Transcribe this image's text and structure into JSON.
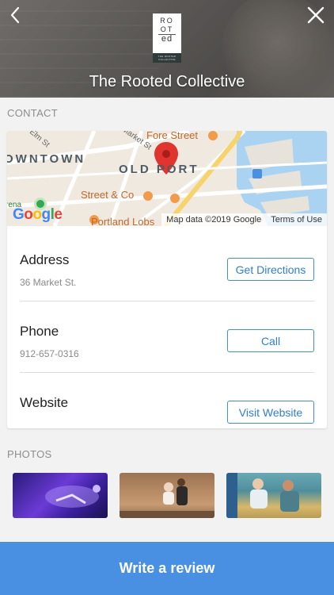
{
  "header": {
    "title": "The Rooted Collective",
    "back_icon": "chevron-left-icon",
    "close_icon": "close-icon",
    "logo": {
      "line1": "RO",
      "line2": "OT",
      "line3": "ed",
      "band": "THE ROOTED COLLECTIVE"
    }
  },
  "contact": {
    "section_label": "CONTACT",
    "map": {
      "labels": {
        "downtown": "OWNTOWN",
        "old_port": "OLD PORT",
        "fore_street": "Fore Street",
        "street_co": "Street & Co",
        "portland_lobster": "Portland Lobs",
        "market_st": "Market St",
        "elm_st": "Elm St",
        "arena": "rena"
      },
      "credit": "Map data ©2019 Google",
      "terms": "Terms of Use",
      "google": "Google"
    },
    "rows": [
      {
        "label": "Address",
        "value": "36 Market St.",
        "button": "Get Directions"
      },
      {
        "label": "Phone",
        "value": "912-657-0316",
        "button": "Call"
      },
      {
        "label": "Website",
        "value": "",
        "button": "Visit Website"
      }
    ]
  },
  "photos": {
    "section_label": "PHOTOS",
    "count": 3
  },
  "footer": {
    "review_label": "Write a review"
  },
  "colors": {
    "accent": "#4a90e2",
    "button_border": "#3f8fdc",
    "section_label": "#8d8d8d",
    "background": "#f2f2f2",
    "map_pin": "#e0342e"
  }
}
